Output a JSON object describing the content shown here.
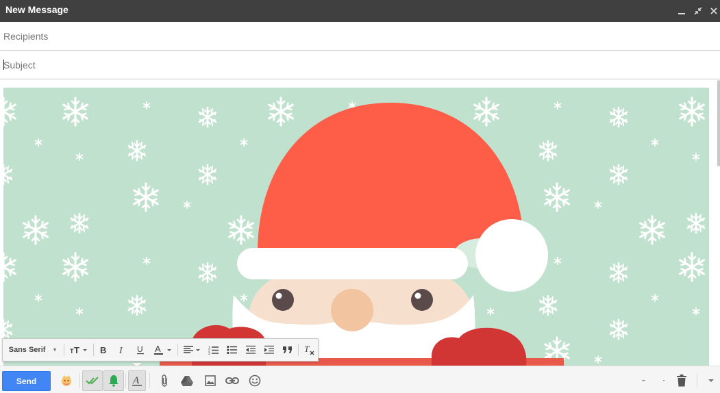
{
  "window": {
    "title": "New Message",
    "controls": [
      "minimize-icon",
      "pop-out-icon",
      "close-icon"
    ]
  },
  "compose": {
    "recipients_placeholder": "Recipients",
    "subject_placeholder": "Subject",
    "subject_value": ""
  },
  "formatting": {
    "font_family": "Sans Serif",
    "tools": [
      "text-size-icon",
      "bold-icon",
      "italic-icon",
      "underline-icon",
      "text-color-icon",
      "align-icon",
      "numbered-list-icon",
      "bulleted-list-icon",
      "indent-less-icon",
      "indent-more-icon",
      "quote-icon",
      "remove-formatting-icon"
    ]
  },
  "bottom_toolbar": {
    "send_label": "Send",
    "tools": [
      "mailtrack-icon",
      "double-check-icon",
      "bell-icon",
      "formatting-options-icon",
      "attach-icon",
      "drive-icon",
      "photo-icon",
      "link-icon",
      "emoji-icon"
    ],
    "trash_icon": "trash-icon",
    "more_icon": "more-options-icon"
  },
  "colors": {
    "titlebar": "#404040",
    "send_button": "#4285f4",
    "image_background": "#c1e1cf",
    "santa_hat": "#fe5d48",
    "santa_trim": "#ffffff",
    "santa_skin": "#f6dfcc",
    "santa_nose": "#f2c4a0",
    "santa_mittens": "#d23634"
  }
}
